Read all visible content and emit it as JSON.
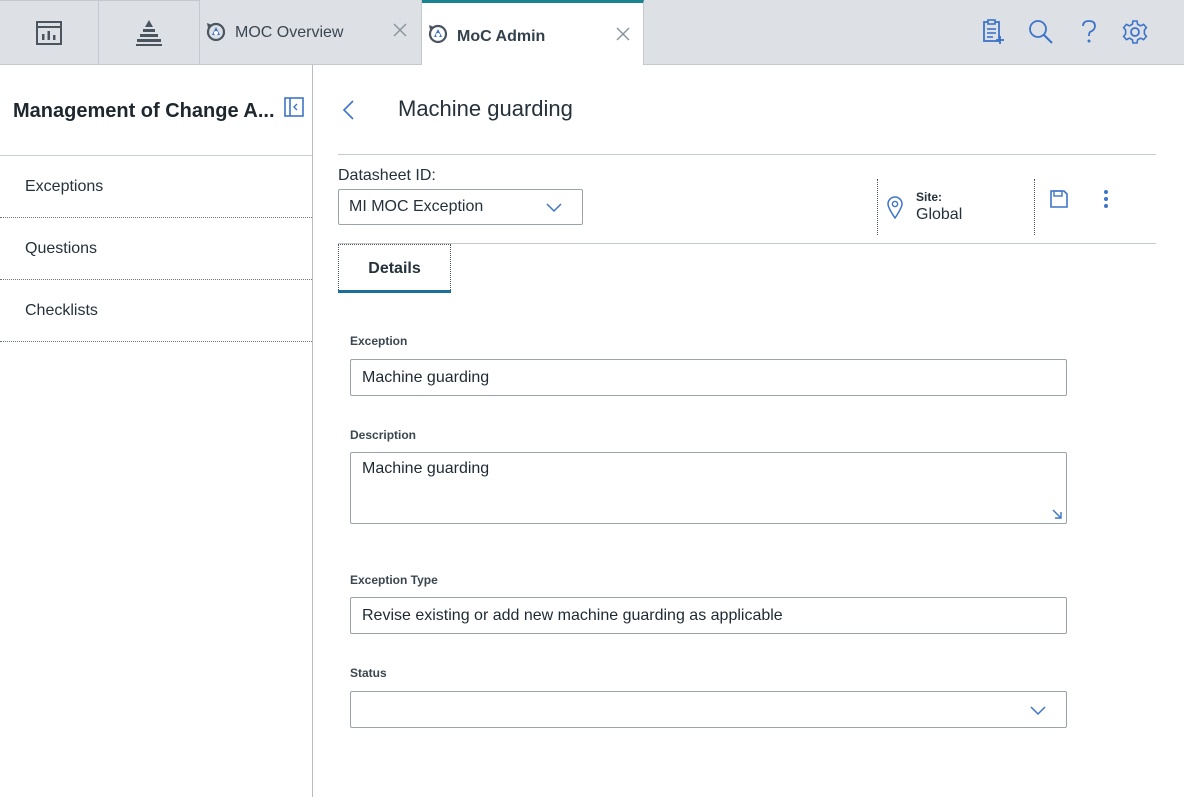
{
  "tabs": [
    {
      "label": "MOC Overview",
      "active": false
    },
    {
      "label": "MoC Admin",
      "active": true
    }
  ],
  "icons": {
    "dashboard": "dashboard-icon",
    "hierarchy": "hierarchy-icon",
    "tab_app": "moc-app-icon",
    "close": "close-icon",
    "queue": "queue-list-icon",
    "search": "search-icon",
    "help": "help-icon",
    "settings": "gear-icon"
  },
  "sidebar": {
    "title": "Management of Change A...",
    "items": [
      {
        "label": "Exceptions"
      },
      {
        "label": "Questions"
      },
      {
        "label": "Checklists"
      }
    ]
  },
  "main": {
    "title": "Machine guarding",
    "datasheet_label": "Datasheet ID:",
    "datasheet_value": "MI MOC Exception",
    "site_label": "Site:",
    "site_value": "Global",
    "tab_details": "Details",
    "fields": {
      "exception_label": "Exception",
      "exception_value": "Machine guarding",
      "description_label": "Description",
      "description_value": "Machine guarding",
      "type_label": "Exception Type",
      "type_value": "Revise existing or add new machine guarding as applicable",
      "status_label": "Status",
      "status_value": ""
    }
  },
  "colors": {
    "accent": "#1b8291",
    "icon_blue": "#3d74c9",
    "topbar": "#dde1e5"
  }
}
